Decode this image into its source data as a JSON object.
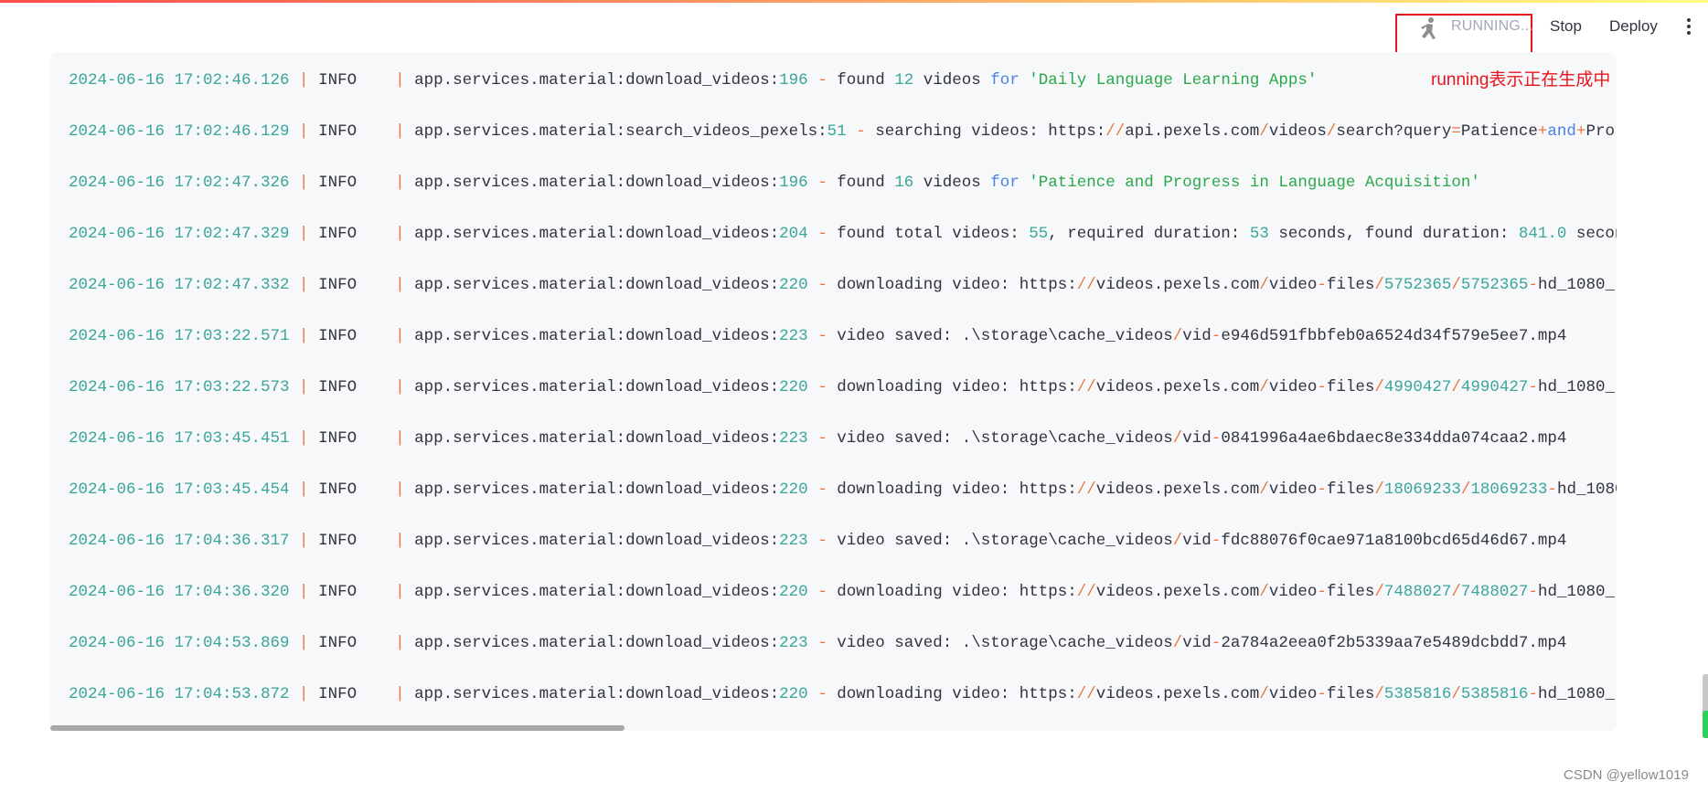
{
  "header": {
    "status_text": "RUNNING...",
    "status_icon": "running-man-icon",
    "stop_label": "Stop",
    "deploy_label": "Deploy",
    "menu_icon": "vertical-dots-icon"
  },
  "annotation": "running表示正在生成中",
  "watermark": "CSDN @yellow1019",
  "colors": {
    "number": "#3aa59a",
    "punct": "#f0743e",
    "keyword": "#4a82e6",
    "string": "#2aa84a",
    "annotation": "#e8141c"
  },
  "log": [
    {
      "timestamp": "2024-06-16 17:02:46.126",
      "level": "INFO",
      "source": "app.services.material:download_videos",
      "lineno": "196",
      "message": [
        [
          "found ",
          "n"
        ],
        [
          "12",
          "t"
        ],
        [
          " videos ",
          "n"
        ],
        [
          "for",
          "b"
        ],
        [
          " ",
          "n"
        ],
        [
          "'Daily Language Learning Apps'",
          "g"
        ]
      ]
    },
    {
      "timestamp": "2024-06-16 17:02:46.129",
      "level": "INFO",
      "source": "app.services.material:search_videos_pexels",
      "lineno": "51",
      "message": [
        [
          "searching videos: https:",
          "n"
        ],
        [
          "//",
          "o"
        ],
        [
          "api.pexels.com",
          "n"
        ],
        [
          "/",
          "o"
        ],
        [
          "videos",
          "n"
        ],
        [
          "/",
          "o"
        ],
        [
          "search?query",
          "n"
        ],
        [
          "=",
          "o"
        ],
        [
          "Patience",
          "n"
        ],
        [
          "+",
          "o"
        ],
        [
          "and",
          "b"
        ],
        [
          "+",
          "o"
        ],
        [
          "Pro",
          "n"
        ]
      ]
    },
    {
      "timestamp": "2024-06-16 17:02:47.326",
      "level": "INFO",
      "source": "app.services.material:download_videos",
      "lineno": "196",
      "message": [
        [
          "found ",
          "n"
        ],
        [
          "16",
          "t"
        ],
        [
          " videos ",
          "n"
        ],
        [
          "for",
          "b"
        ],
        [
          " ",
          "n"
        ],
        [
          "'Patience and Progress in Language Acquisition'",
          "g"
        ]
      ]
    },
    {
      "timestamp": "2024-06-16 17:02:47.329",
      "level": "INFO",
      "source": "app.services.material:download_videos",
      "lineno": "204",
      "message": [
        [
          "found total videos: ",
          "n"
        ],
        [
          "55",
          "t"
        ],
        [
          ", required duration: ",
          "n"
        ],
        [
          "53",
          "t"
        ],
        [
          " seconds, found duration: ",
          "n"
        ],
        [
          "841.0",
          "t"
        ],
        [
          " seconds",
          "n"
        ]
      ]
    },
    {
      "timestamp": "2024-06-16 17:02:47.332",
      "level": "INFO",
      "source": "app.services.material:download_videos",
      "lineno": "220",
      "message": [
        [
          "downloading video: https:",
          "n"
        ],
        [
          "//",
          "o"
        ],
        [
          "videos.pexels.com",
          "n"
        ],
        [
          "/",
          "o"
        ],
        [
          "video",
          "n"
        ],
        [
          "-",
          "o"
        ],
        [
          "files",
          "n"
        ],
        [
          "/",
          "o"
        ],
        [
          "5752365",
          "t"
        ],
        [
          "/",
          "o"
        ],
        [
          "5752365",
          "t"
        ],
        [
          "-",
          "o"
        ],
        [
          "hd_1080_",
          "n"
        ]
      ]
    },
    {
      "timestamp": "2024-06-16 17:03:22.571",
      "level": "INFO",
      "source": "app.services.material:download_videos",
      "lineno": "223",
      "message": [
        [
          "video saved: .\\storage\\cache_videos",
          "n"
        ],
        [
          "/",
          "o"
        ],
        [
          "vid",
          "n"
        ],
        [
          "-",
          "o"
        ],
        [
          "e946d591fbbfeb0a6524d34f579e5ee7.mp4",
          "n"
        ]
      ]
    },
    {
      "timestamp": "2024-06-16 17:03:22.573",
      "level": "INFO",
      "source": "app.services.material:download_videos",
      "lineno": "220",
      "message": [
        [
          "downloading video: https:",
          "n"
        ],
        [
          "//",
          "o"
        ],
        [
          "videos.pexels.com",
          "n"
        ],
        [
          "/",
          "o"
        ],
        [
          "video",
          "n"
        ],
        [
          "-",
          "o"
        ],
        [
          "files",
          "n"
        ],
        [
          "/",
          "o"
        ],
        [
          "4990427",
          "t"
        ],
        [
          "/",
          "o"
        ],
        [
          "4990427",
          "t"
        ],
        [
          "-",
          "o"
        ],
        [
          "hd_1080_",
          "n"
        ]
      ]
    },
    {
      "timestamp": "2024-06-16 17:03:45.451",
      "level": "INFO",
      "source": "app.services.material:download_videos",
      "lineno": "223",
      "message": [
        [
          "video saved: .\\storage\\cache_videos",
          "n"
        ],
        [
          "/",
          "o"
        ],
        [
          "vid",
          "n"
        ],
        [
          "-",
          "o"
        ],
        [
          "0841996a4ae6bdaec8e334dda074caa2.mp4",
          "n"
        ]
      ]
    },
    {
      "timestamp": "2024-06-16 17:03:45.454",
      "level": "INFO",
      "source": "app.services.material:download_videos",
      "lineno": "220",
      "message": [
        [
          "downloading video: https:",
          "n"
        ],
        [
          "//",
          "o"
        ],
        [
          "videos.pexels.com",
          "n"
        ],
        [
          "/",
          "o"
        ],
        [
          "video",
          "n"
        ],
        [
          "-",
          "o"
        ],
        [
          "files",
          "n"
        ],
        [
          "/",
          "o"
        ],
        [
          "18069233",
          "t"
        ],
        [
          "/",
          "o"
        ],
        [
          "18069233",
          "t"
        ],
        [
          "-",
          "o"
        ],
        [
          "hd_1080",
          "n"
        ]
      ]
    },
    {
      "timestamp": "2024-06-16 17:04:36.317",
      "level": "INFO",
      "source": "app.services.material:download_videos",
      "lineno": "223",
      "message": [
        [
          "video saved: .\\storage\\cache_videos",
          "n"
        ],
        [
          "/",
          "o"
        ],
        [
          "vid",
          "n"
        ],
        [
          "-",
          "o"
        ],
        [
          "fdc88076f0cae971a8100bcd65d46d67.mp4",
          "n"
        ]
      ]
    },
    {
      "timestamp": "2024-06-16 17:04:36.320",
      "level": "INFO",
      "source": "app.services.material:download_videos",
      "lineno": "220",
      "message": [
        [
          "downloading video: https:",
          "n"
        ],
        [
          "//",
          "o"
        ],
        [
          "videos.pexels.com",
          "n"
        ],
        [
          "/",
          "o"
        ],
        [
          "video",
          "n"
        ],
        [
          "-",
          "o"
        ],
        [
          "files",
          "n"
        ],
        [
          "/",
          "o"
        ],
        [
          "7488027",
          "t"
        ],
        [
          "/",
          "o"
        ],
        [
          "7488027",
          "t"
        ],
        [
          "-",
          "o"
        ],
        [
          "hd_1080_",
          "n"
        ]
      ]
    },
    {
      "timestamp": "2024-06-16 17:04:53.869",
      "level": "INFO",
      "source": "app.services.material:download_videos",
      "lineno": "223",
      "message": [
        [
          "video saved: .\\storage\\cache_videos",
          "n"
        ],
        [
          "/",
          "o"
        ],
        [
          "vid",
          "n"
        ],
        [
          "-",
          "o"
        ],
        [
          "2a784a2eea0f2b5339aa7e5489dcbdd7.mp4",
          "n"
        ]
      ]
    },
    {
      "timestamp": "2024-06-16 17:04:53.872",
      "level": "INFO",
      "source": "app.services.material:download_videos",
      "lineno": "220",
      "message": [
        [
          "downloading video: https:",
          "n"
        ],
        [
          "//",
          "o"
        ],
        [
          "videos.pexels.com",
          "n"
        ],
        [
          "/",
          "o"
        ],
        [
          "video",
          "n"
        ],
        [
          "-",
          "o"
        ],
        [
          "files",
          "n"
        ],
        [
          "/",
          "o"
        ],
        [
          "5385816",
          "t"
        ],
        [
          "/",
          "o"
        ],
        [
          "5385816",
          "t"
        ],
        [
          "-",
          "o"
        ],
        [
          "hd_1080_",
          "n"
        ]
      ]
    }
  ]
}
